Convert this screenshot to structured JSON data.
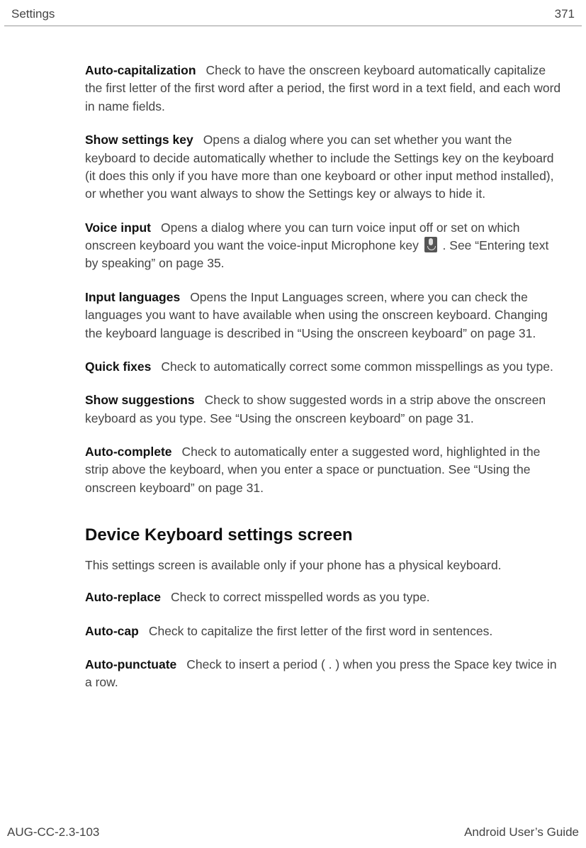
{
  "header": {
    "title": "Settings",
    "page": "371"
  },
  "entries": [
    {
      "term": "Auto-capitalization",
      "desc": "Check to have the onscreen keyboard automatically capitalize the first letter of the first word after a period, the first word in a text field, and each word in name fields."
    },
    {
      "term": "Show settings key",
      "desc": "Opens a dialog where you can set whether you want the keyboard to decide automatically whether to include the Settings key on the keyboard (it does this only if you have more than one keyboard or other input method installed), or whether you want always to show the Settings key or always to hide it."
    },
    {
      "term": "Voice input",
      "desc_pre": "Opens a dialog where you can turn voice input off or set on which onscreen keyboard you want the voice-input Microphone key ",
      "desc_post": " . See “Entering text by speaking” on page 35.",
      "has_icon": true
    },
    {
      "term": "Input languages",
      "desc": "Opens the Input Languages screen, where you can check the languages you want to have available when using the onscreen keyboard. Changing the keyboard language is described in “Using the onscreen keyboard” on page 31."
    },
    {
      "term": "Quick fixes",
      "desc": "Check to automatically correct some common misspellings as you type."
    },
    {
      "term": "Show suggestions",
      "desc": "Check to show suggested words in a strip above the onscreen keyboard as you type. See “Using the onscreen keyboard” on page 31."
    },
    {
      "term": "Auto-complete",
      "desc": "Check to automatically enter a suggested word, highlighted in the strip above the keyboard, when you enter a space or punctuation. See “Using the onscreen keyboard” on page 31."
    }
  ],
  "section": {
    "heading": "Device Keyboard settings screen",
    "intro": "This settings screen is available only if your phone has a physical keyboard.",
    "entries": [
      {
        "term": "Auto-replace",
        "desc": "Check to correct misspelled words as you type."
      },
      {
        "term": "Auto-cap",
        "desc": "Check to capitalize the first letter of the first word in sentences."
      },
      {
        "term": "Auto-punctuate",
        "desc": "Check to insert a period ( . ) when you press the Space key twice in a row."
      }
    ]
  },
  "footer": {
    "left": "AUG-CC-2.3-103",
    "right": "Android User’s Guide"
  }
}
